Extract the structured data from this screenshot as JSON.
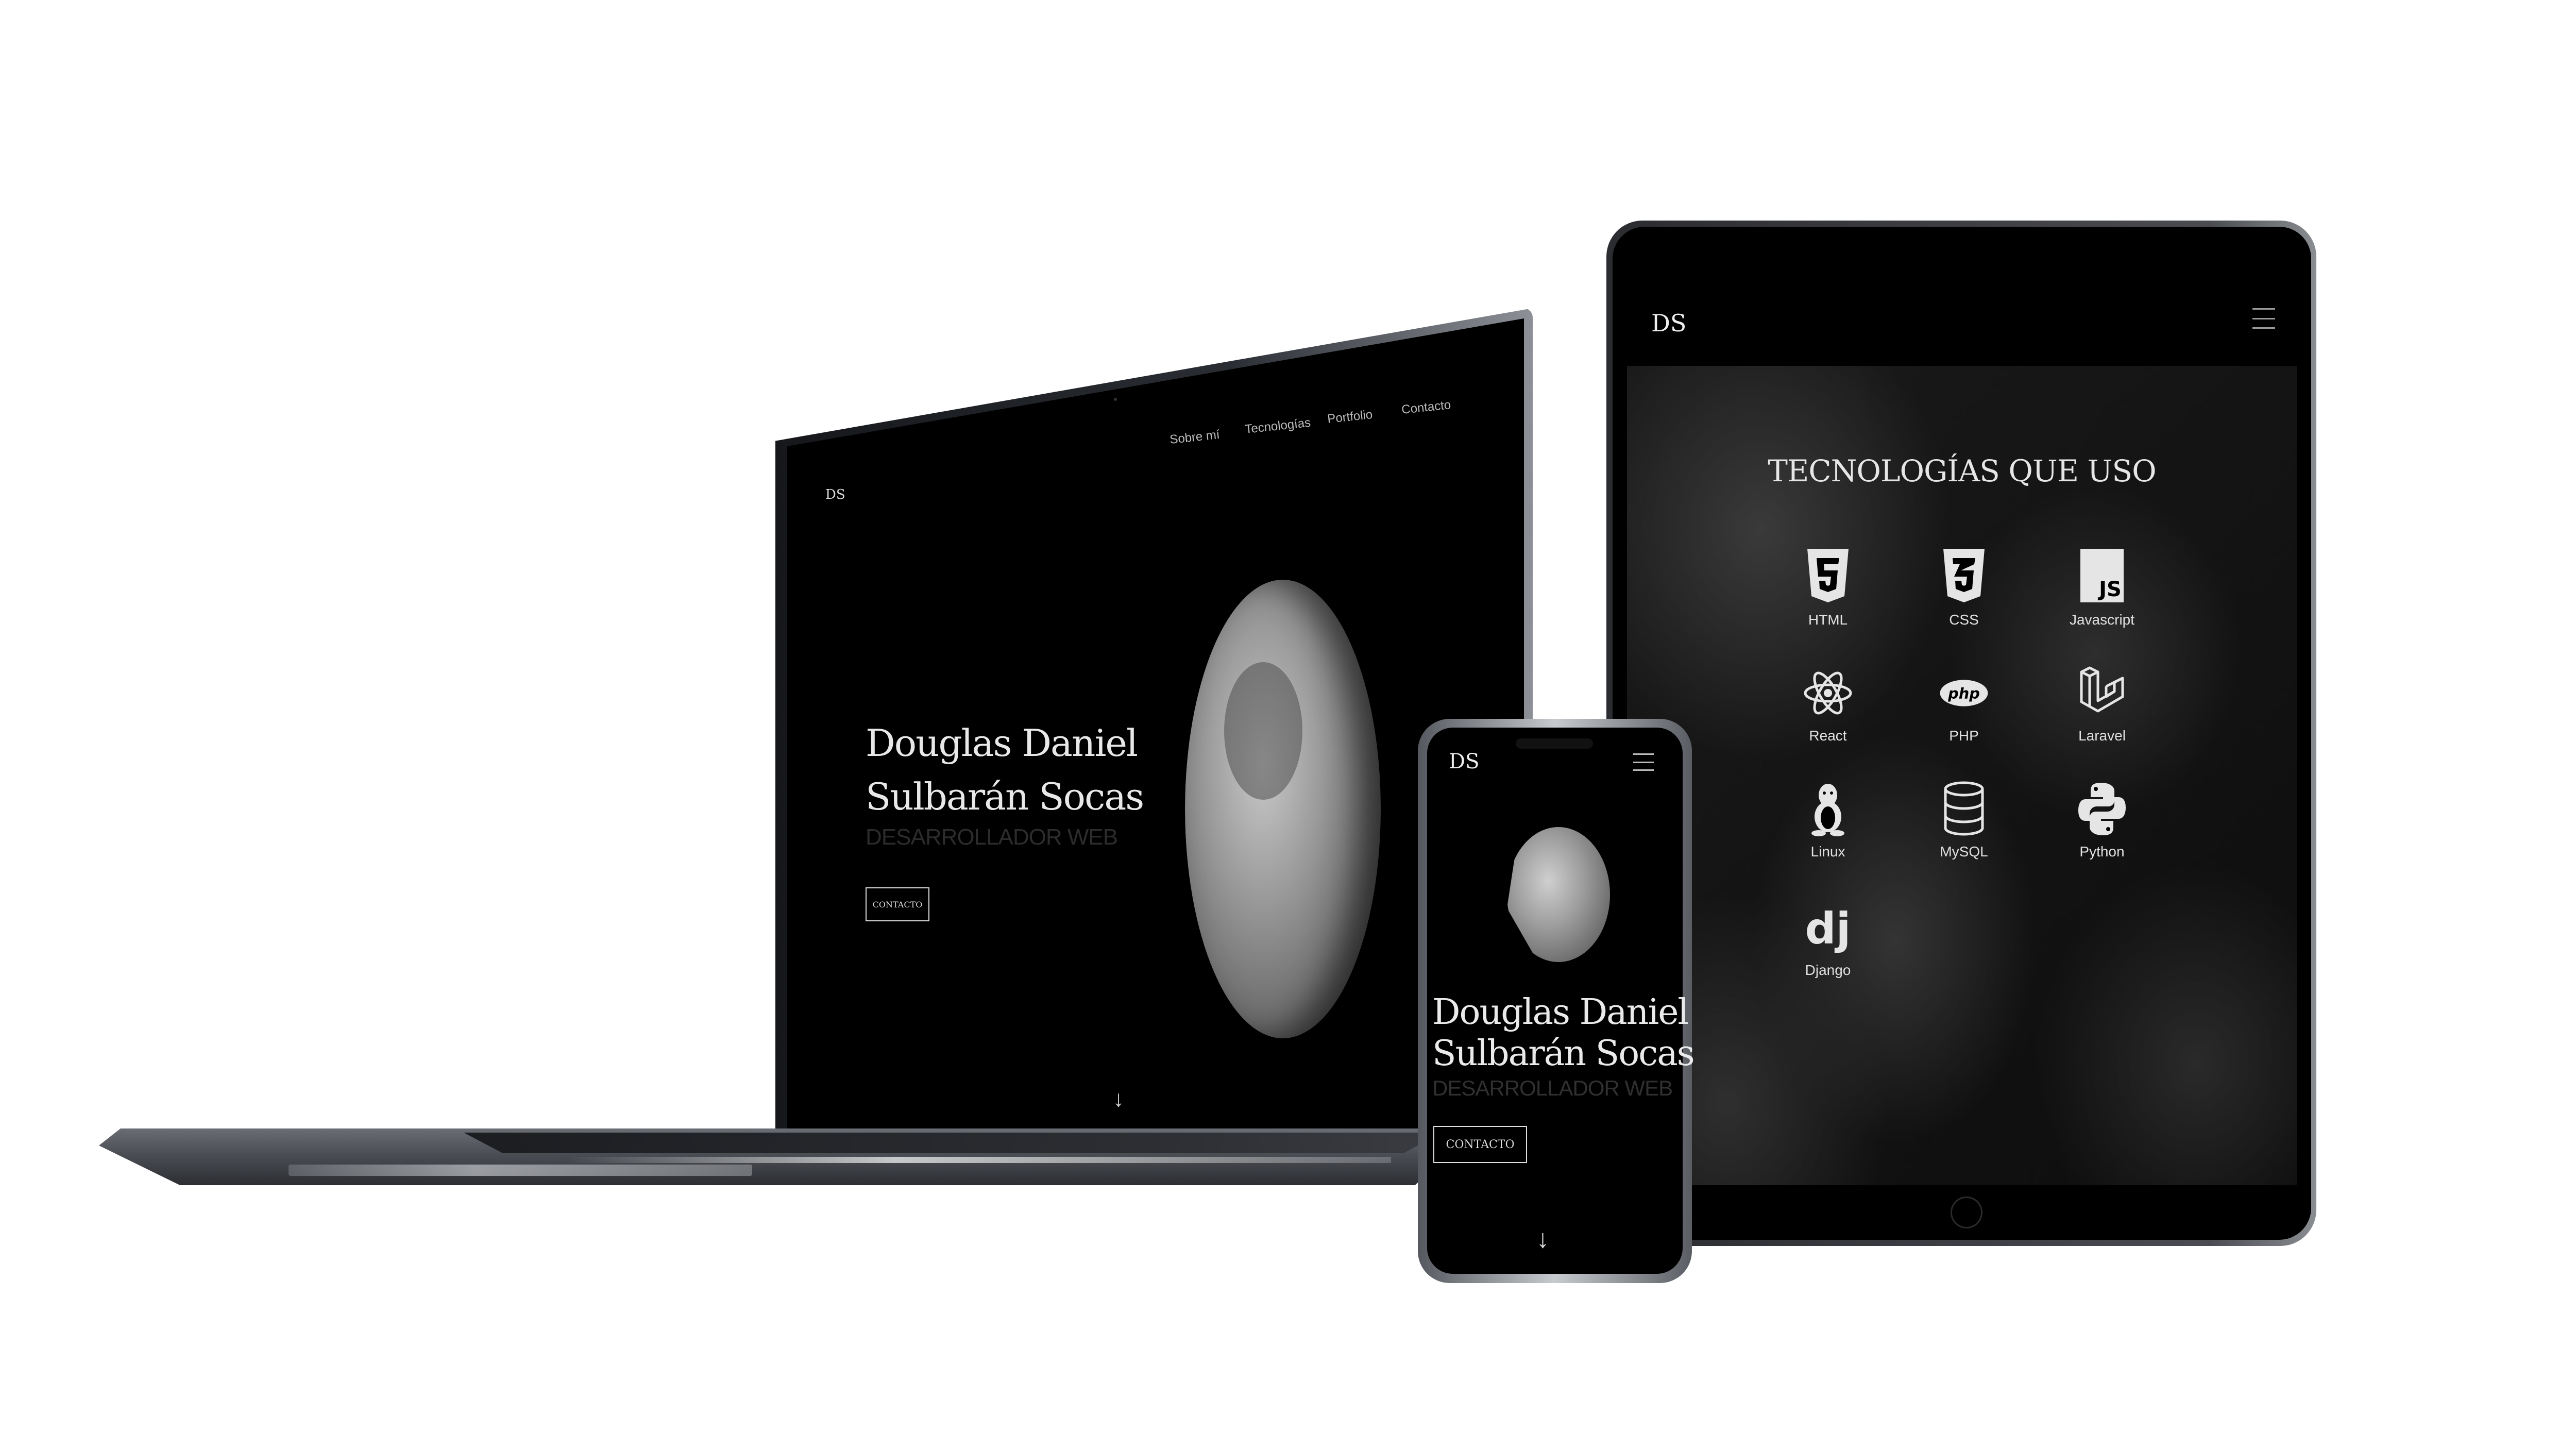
{
  "laptop": {
    "logo": "DS",
    "nav": [
      "Sobre mí",
      "Tecnologías",
      "Portfolio",
      "Contacto"
    ],
    "name_line1": "Douglas Daniel",
    "name_line2": "Sulbarán Socas",
    "role": "DESARROLLADOR WEB",
    "contact_button": "CONTACTO",
    "scroll_arrow": "↓"
  },
  "tablet": {
    "logo": "DS",
    "section_title": "TECNOLOGÍAS QUE USO",
    "technologies": [
      {
        "label": "HTML",
        "icon": "html5-icon"
      },
      {
        "label": "CSS",
        "icon": "css3-icon"
      },
      {
        "label": "Javascript",
        "icon": "javascript-icon"
      },
      {
        "label": "React",
        "icon": "react-icon"
      },
      {
        "label": "PHP",
        "icon": "php-icon"
      },
      {
        "label": "Laravel",
        "icon": "laravel-icon"
      },
      {
        "label": "Linux",
        "icon": "linux-icon"
      },
      {
        "label": "MySQL",
        "icon": "mysql-icon"
      },
      {
        "label": "Python",
        "icon": "python-icon"
      },
      {
        "label": "Django",
        "icon": "django-icon"
      }
    ],
    "menu_icon": "hamburger-menu-icon"
  },
  "phone": {
    "logo": "DS",
    "name_line1": "Douglas Daniel",
    "name_line2": "Sulbarán Socas",
    "role": "DESARROLLADOR WEB",
    "contact_button": "CONTACTO",
    "scroll_arrow": "↓",
    "menu_icon": "hamburger-menu-icon"
  },
  "colors": {
    "screen_background": "#000000",
    "text_primary": "#e8e8e8",
    "role_text": "#2c2c2c",
    "page_background": "#ffffff"
  }
}
